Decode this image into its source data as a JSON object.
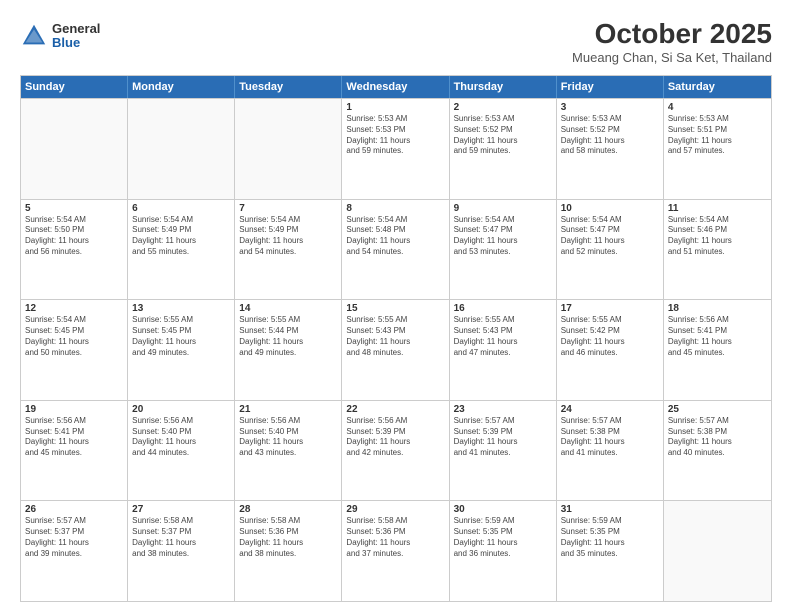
{
  "logo": {
    "general": "General",
    "blue": "Blue"
  },
  "header": {
    "title": "October 2025",
    "subtitle": "Mueang Chan, Si Sa Ket, Thailand"
  },
  "dayHeaders": [
    "Sunday",
    "Monday",
    "Tuesday",
    "Wednesday",
    "Thursday",
    "Friday",
    "Saturday"
  ],
  "weeks": [
    [
      {
        "day": "",
        "info": "",
        "empty": true
      },
      {
        "day": "",
        "info": "",
        "empty": true
      },
      {
        "day": "",
        "info": "",
        "empty": true
      },
      {
        "day": "1",
        "info": "Sunrise: 5:53 AM\nSunset: 5:53 PM\nDaylight: 11 hours\nand 59 minutes."
      },
      {
        "day": "2",
        "info": "Sunrise: 5:53 AM\nSunset: 5:52 PM\nDaylight: 11 hours\nand 59 minutes."
      },
      {
        "day": "3",
        "info": "Sunrise: 5:53 AM\nSunset: 5:52 PM\nDaylight: 11 hours\nand 58 minutes."
      },
      {
        "day": "4",
        "info": "Sunrise: 5:53 AM\nSunset: 5:51 PM\nDaylight: 11 hours\nand 57 minutes."
      }
    ],
    [
      {
        "day": "5",
        "info": "Sunrise: 5:54 AM\nSunset: 5:50 PM\nDaylight: 11 hours\nand 56 minutes."
      },
      {
        "day": "6",
        "info": "Sunrise: 5:54 AM\nSunset: 5:49 PM\nDaylight: 11 hours\nand 55 minutes."
      },
      {
        "day": "7",
        "info": "Sunrise: 5:54 AM\nSunset: 5:49 PM\nDaylight: 11 hours\nand 54 minutes."
      },
      {
        "day": "8",
        "info": "Sunrise: 5:54 AM\nSunset: 5:48 PM\nDaylight: 11 hours\nand 54 minutes."
      },
      {
        "day": "9",
        "info": "Sunrise: 5:54 AM\nSunset: 5:47 PM\nDaylight: 11 hours\nand 53 minutes."
      },
      {
        "day": "10",
        "info": "Sunrise: 5:54 AM\nSunset: 5:47 PM\nDaylight: 11 hours\nand 52 minutes."
      },
      {
        "day": "11",
        "info": "Sunrise: 5:54 AM\nSunset: 5:46 PM\nDaylight: 11 hours\nand 51 minutes."
      }
    ],
    [
      {
        "day": "12",
        "info": "Sunrise: 5:54 AM\nSunset: 5:45 PM\nDaylight: 11 hours\nand 50 minutes."
      },
      {
        "day": "13",
        "info": "Sunrise: 5:55 AM\nSunset: 5:45 PM\nDaylight: 11 hours\nand 49 minutes."
      },
      {
        "day": "14",
        "info": "Sunrise: 5:55 AM\nSunset: 5:44 PM\nDaylight: 11 hours\nand 49 minutes."
      },
      {
        "day": "15",
        "info": "Sunrise: 5:55 AM\nSunset: 5:43 PM\nDaylight: 11 hours\nand 48 minutes."
      },
      {
        "day": "16",
        "info": "Sunrise: 5:55 AM\nSunset: 5:43 PM\nDaylight: 11 hours\nand 47 minutes."
      },
      {
        "day": "17",
        "info": "Sunrise: 5:55 AM\nSunset: 5:42 PM\nDaylight: 11 hours\nand 46 minutes."
      },
      {
        "day": "18",
        "info": "Sunrise: 5:56 AM\nSunset: 5:41 PM\nDaylight: 11 hours\nand 45 minutes."
      }
    ],
    [
      {
        "day": "19",
        "info": "Sunrise: 5:56 AM\nSunset: 5:41 PM\nDaylight: 11 hours\nand 45 minutes."
      },
      {
        "day": "20",
        "info": "Sunrise: 5:56 AM\nSunset: 5:40 PM\nDaylight: 11 hours\nand 44 minutes."
      },
      {
        "day": "21",
        "info": "Sunrise: 5:56 AM\nSunset: 5:40 PM\nDaylight: 11 hours\nand 43 minutes."
      },
      {
        "day": "22",
        "info": "Sunrise: 5:56 AM\nSunset: 5:39 PM\nDaylight: 11 hours\nand 42 minutes."
      },
      {
        "day": "23",
        "info": "Sunrise: 5:57 AM\nSunset: 5:39 PM\nDaylight: 11 hours\nand 41 minutes."
      },
      {
        "day": "24",
        "info": "Sunrise: 5:57 AM\nSunset: 5:38 PM\nDaylight: 11 hours\nand 41 minutes."
      },
      {
        "day": "25",
        "info": "Sunrise: 5:57 AM\nSunset: 5:38 PM\nDaylight: 11 hours\nand 40 minutes."
      }
    ],
    [
      {
        "day": "26",
        "info": "Sunrise: 5:57 AM\nSunset: 5:37 PM\nDaylight: 11 hours\nand 39 minutes."
      },
      {
        "day": "27",
        "info": "Sunrise: 5:58 AM\nSunset: 5:37 PM\nDaylight: 11 hours\nand 38 minutes."
      },
      {
        "day": "28",
        "info": "Sunrise: 5:58 AM\nSunset: 5:36 PM\nDaylight: 11 hours\nand 38 minutes."
      },
      {
        "day": "29",
        "info": "Sunrise: 5:58 AM\nSunset: 5:36 PM\nDaylight: 11 hours\nand 37 minutes."
      },
      {
        "day": "30",
        "info": "Sunrise: 5:59 AM\nSunset: 5:35 PM\nDaylight: 11 hours\nand 36 minutes."
      },
      {
        "day": "31",
        "info": "Sunrise: 5:59 AM\nSunset: 5:35 PM\nDaylight: 11 hours\nand 35 minutes."
      },
      {
        "day": "",
        "info": "",
        "empty": true
      }
    ]
  ]
}
